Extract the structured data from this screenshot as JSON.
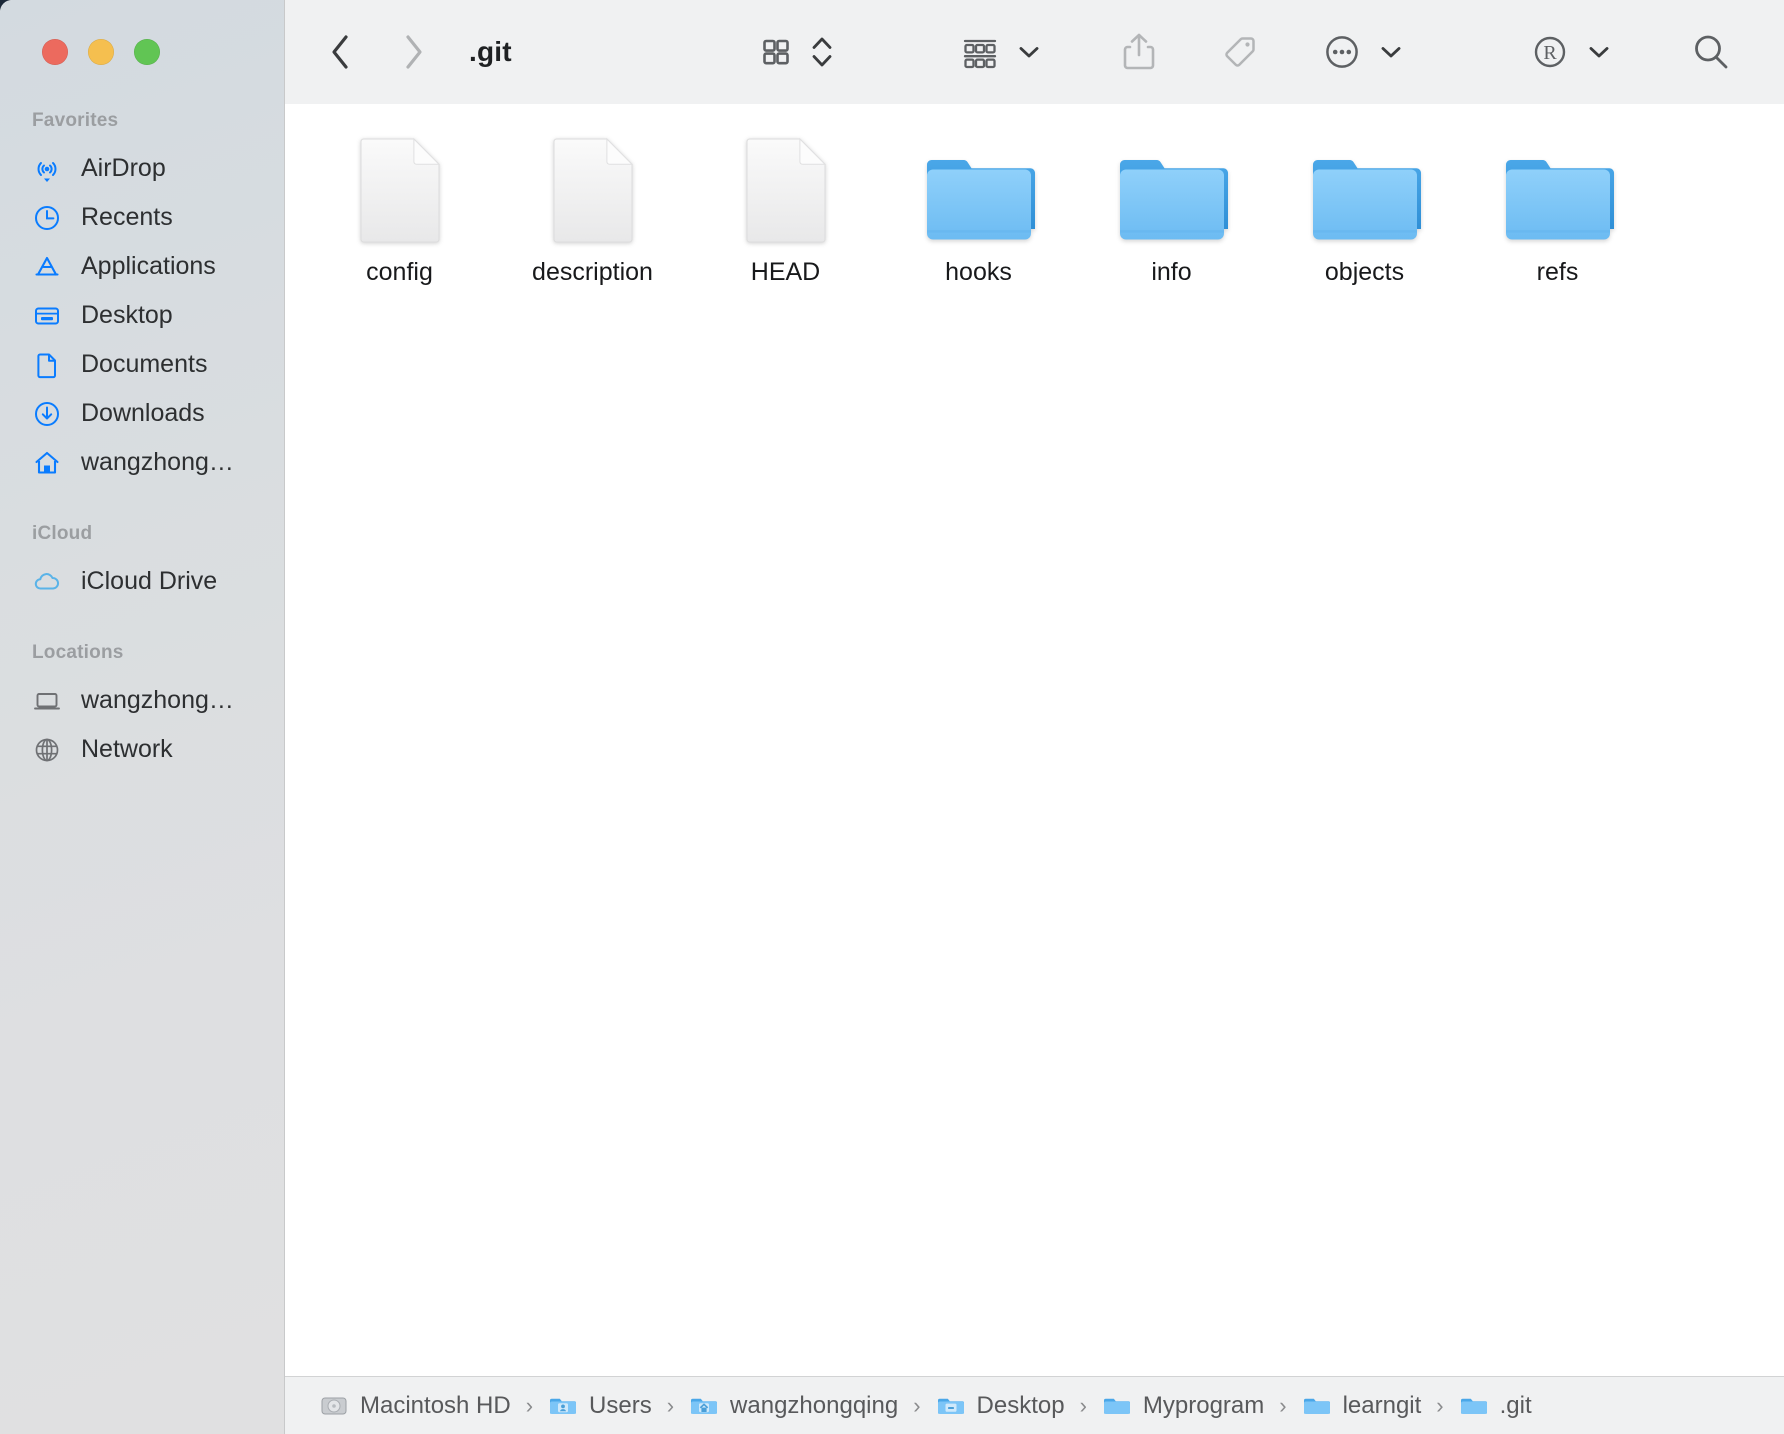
{
  "window": {
    "title": ".git",
    "traffic_lights": [
      {
        "name": "close",
        "color": "#ec6a5e"
      },
      {
        "name": "minimize",
        "color": "#f5bf4f"
      },
      {
        "name": "maximize",
        "color": "#61c554"
      }
    ]
  },
  "toolbar": {
    "back_icon": "chevron-left-icon",
    "forward_icon": "chevron-right-icon",
    "view_icon": "grid-view-icon",
    "view_stepper_icon": "chevron-up-down-icon",
    "group_icon": "group-by-icon",
    "group_chevron_icon": "chevron-down-icon",
    "share_icon": "share-icon",
    "tag_icon": "tag-icon",
    "more_icon": "ellipsis-circle-icon",
    "more_chevron_icon": "chevron-down-icon",
    "action_icon": "circled-r-icon",
    "action_chevron_icon": "chevron-down-icon",
    "search_icon": "search-icon"
  },
  "sidebar": {
    "sections": [
      {
        "title": "Favorites",
        "items": [
          {
            "label": "AirDrop",
            "icon": "airdrop-icon",
            "tint": "blue"
          },
          {
            "label": "Recents",
            "icon": "clock-icon",
            "tint": "blue"
          },
          {
            "label": "Applications",
            "icon": "applications-icon",
            "tint": "blue"
          },
          {
            "label": "Desktop",
            "icon": "desktop-icon",
            "tint": "blue"
          },
          {
            "label": "Documents",
            "icon": "document-icon",
            "tint": "blue"
          },
          {
            "label": "Downloads",
            "icon": "downloads-icon",
            "tint": "blue"
          },
          {
            "label": "wangzhong…",
            "icon": "home-icon",
            "tint": "blue"
          }
        ]
      },
      {
        "title": "iCloud",
        "items": [
          {
            "label": "iCloud Drive",
            "icon": "cloud-icon",
            "tint": "lightblue"
          }
        ]
      },
      {
        "title": "Locations",
        "items": [
          {
            "label": "wangzhong…",
            "icon": "laptop-icon",
            "tint": "gray"
          },
          {
            "label": "Network",
            "icon": "network-icon",
            "tint": "gray"
          }
        ]
      }
    ]
  },
  "content": {
    "items": [
      {
        "label": "config",
        "kind": "file"
      },
      {
        "label": "description",
        "kind": "file"
      },
      {
        "label": "HEAD",
        "kind": "file"
      },
      {
        "label": "hooks",
        "kind": "folder"
      },
      {
        "label": "info",
        "kind": "folder"
      },
      {
        "label": "objects",
        "kind": "folder"
      },
      {
        "label": "refs",
        "kind": "folder"
      }
    ]
  },
  "pathbar": {
    "crumbs": [
      {
        "label": "Macintosh HD",
        "icon": "hard-drive-icon"
      },
      {
        "label": "Users",
        "icon": "users-folder-icon"
      },
      {
        "label": "wangzhongqing",
        "icon": "home-folder-icon"
      },
      {
        "label": "Desktop",
        "icon": "desktop-folder-icon"
      },
      {
        "label": "Myprogram",
        "icon": "folder-icon"
      },
      {
        "label": "learngit",
        "icon": "folder-icon"
      },
      {
        "label": ".git",
        "icon": "folder-icon"
      }
    ],
    "separator": "›"
  },
  "colors": {
    "accent_blue": "#0a7cff",
    "folder_blue": "#74c0f6",
    "folder_blue_dark": "#3d9de0",
    "sidebar_bg": "#d9dce0",
    "toolbar_bg": "#f0f1f2"
  }
}
